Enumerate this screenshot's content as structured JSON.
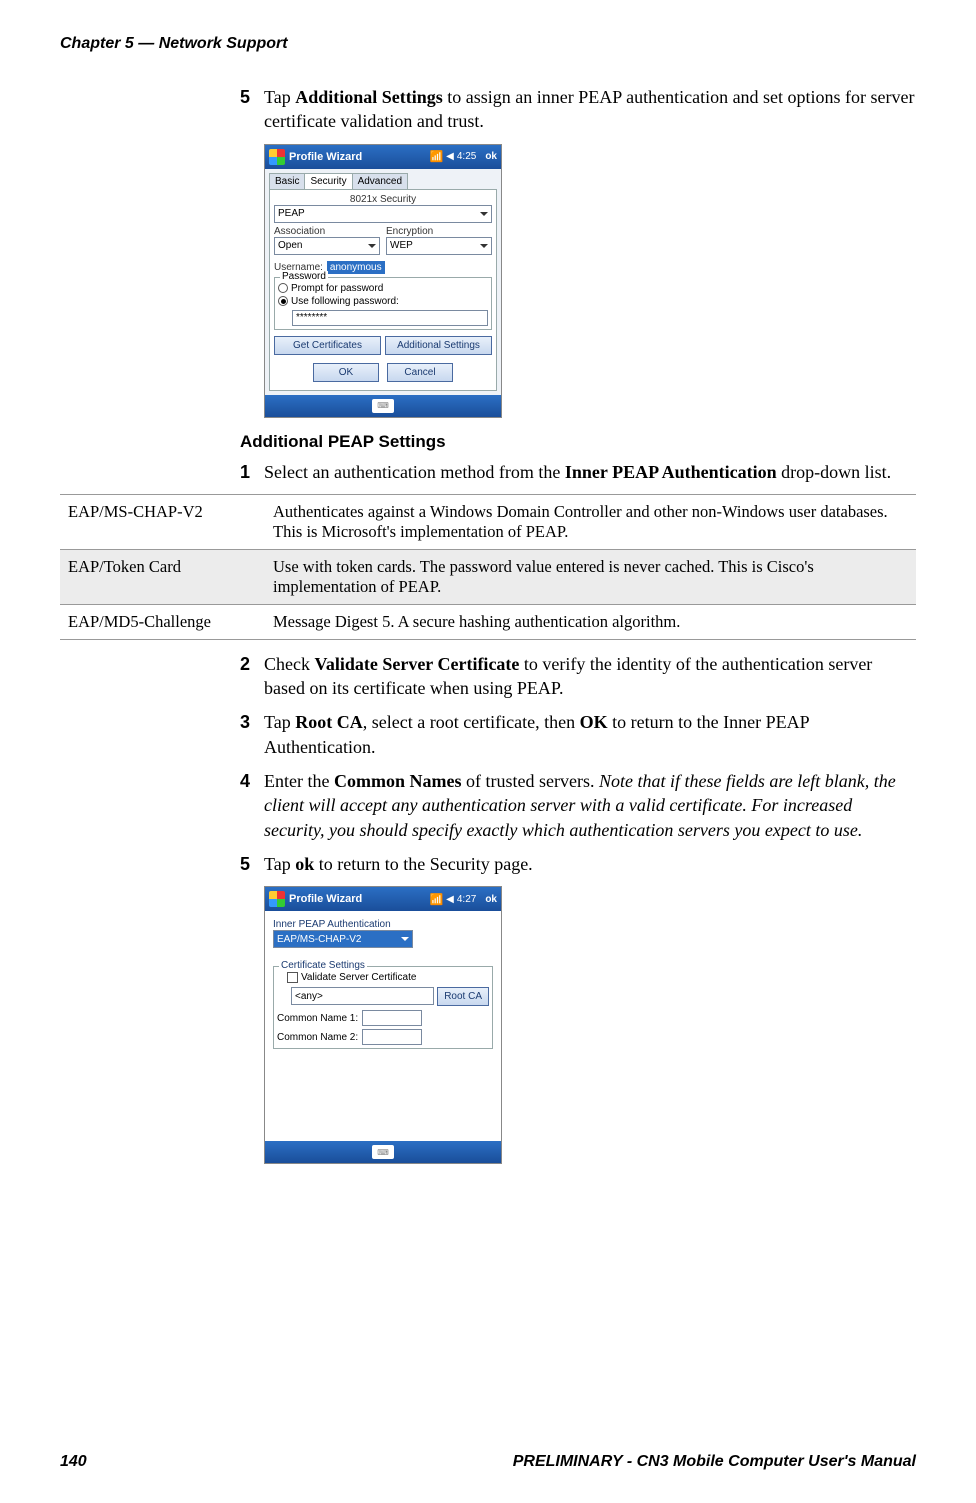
{
  "header": {
    "chapter": "Chapter 5 — Network Support"
  },
  "step5": {
    "num": "5",
    "pre": "Tap ",
    "bold": "Additional Settings",
    "post": " to assign an inner PEAP authentication and set options for server certificate validation and trust."
  },
  "ss1": {
    "title": "Profile Wizard",
    "time": "4:25",
    "ok": "ok",
    "tabs": {
      "basic": "Basic",
      "security": "Security",
      "advanced": "Advanced"
    },
    "sec_label": "8021x Security",
    "sec_value": "PEAP",
    "assoc_label": "Association",
    "assoc_value": "Open",
    "enc_label": "Encryption",
    "enc_value": "WEP",
    "uname_label": "Username:",
    "uname_value": "anonymous",
    "pwd_legend": "Password",
    "prompt": "Prompt for password",
    "usepwd": "Use following password:",
    "pwd_value": "********",
    "getcert": "Get Certificates",
    "addl": "Additional Settings",
    "okbtn": "OK",
    "cancel": "Cancel"
  },
  "subhead": "Additional PEAP Settings",
  "step1": {
    "num": "1",
    "pre": "Select an authentication method from the ",
    "bold": "Inner PEAP Authentication",
    "post": " drop-down list."
  },
  "table": {
    "r1m": "EAP/MS-CHAP-V2",
    "r1d": "Authenticates against a Windows Domain Controller and other non-Windows user databases. This is Microsoft's implementation of PEAP.",
    "r2m": "EAP/Token Card",
    "r2d": "Use with token cards. The password value entered is never cached. This is Cisco's implementation of PEAP.",
    "r3m": "EAP/MD5-Challenge",
    "r3d": "Message Digest 5. A secure hashing authentication algorithm."
  },
  "step2": {
    "num": "2",
    "pre": "Check ",
    "bold": "Validate Server Certificate",
    "post": " to verify the identity of the authentication server based on its certificate when using PEAP."
  },
  "step3": {
    "num": "3",
    "pre": "Tap ",
    "bold1": "Root CA",
    "mid": ", select a root certificate, then ",
    "bold2": "OK",
    "post": " to return to the Inner PEAP Authentication."
  },
  "step4": {
    "num": "4",
    "pre": "Enter the ",
    "bold": "Common Names",
    "mid": " of trusted servers. ",
    "italic": "Note that if these fields are left blank, the client will accept any authentication server with a valid certificate. For increased security, you should specify exactly which authentication servers you expect to use."
  },
  "step5b": {
    "num": "5",
    "pre": "Tap ",
    "bold": "ok",
    "post": " to return to the Security page."
  },
  "ss2": {
    "title": "Profile Wizard",
    "time": "4:27",
    "ok": "ok",
    "inner_label": "Inner PEAP Authentication",
    "inner_value": "EAP/MS-CHAP-V2",
    "cert_legend": "Certificate Settings",
    "validate": "Validate Server Certificate",
    "any": "<any>",
    "rootca": "Root CA",
    "cn1": "Common Name 1:",
    "cn2": "Common Name 2:"
  },
  "footer": {
    "page": "140",
    "manual": "PRELIMINARY - CN3 Mobile Computer User's Manual"
  }
}
